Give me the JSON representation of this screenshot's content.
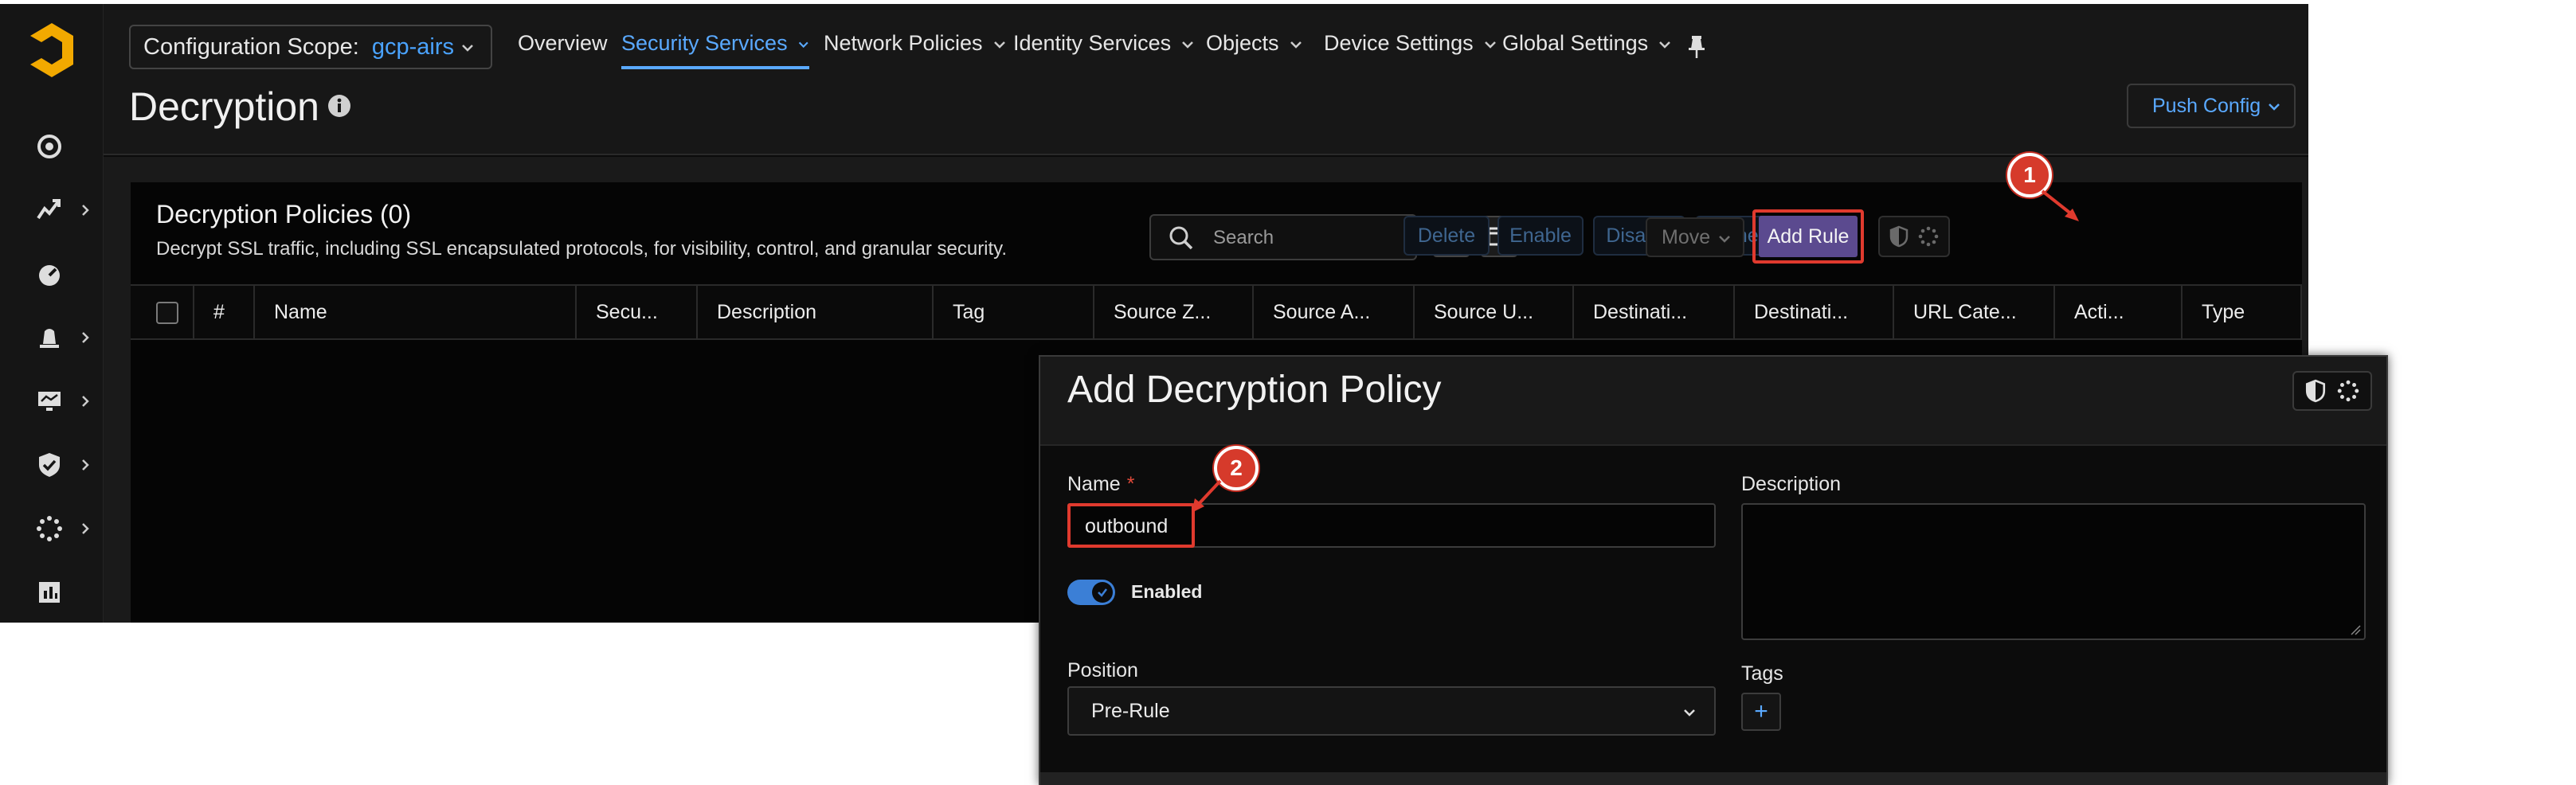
{
  "app": {
    "scope_label": "Configuration Scope:",
    "scope_value": "gcp-airs",
    "nav": [
      {
        "label": "Overview",
        "has_menu": false
      },
      {
        "label": "Security Services",
        "has_menu": true,
        "active": true
      },
      {
        "label": "Network Policies",
        "has_menu": true
      },
      {
        "label": "Identity Services",
        "has_menu": true
      },
      {
        "label": "Objects",
        "has_menu": true
      },
      {
        "label": "Device Settings",
        "has_menu": true
      },
      {
        "label": "Global Settings",
        "has_menu": true
      }
    ],
    "page_title": "Decryption",
    "push_config": "Push Config",
    "accent_color": "#5aa9ff",
    "brand_color": "#f2a900"
  },
  "sidebar": {
    "items": [
      {
        "icon": "target-icon",
        "has_chevron": false
      },
      {
        "icon": "activity-icon",
        "has_chevron": true
      },
      {
        "icon": "gauge-icon",
        "has_chevron": false
      },
      {
        "icon": "alert-icon",
        "has_chevron": true
      },
      {
        "icon": "monitor-icon",
        "has_chevron": true
      },
      {
        "icon": "shield-check-icon",
        "has_chevron": true
      },
      {
        "icon": "settings-dots-icon",
        "has_chevron": true
      },
      {
        "icon": "report-icon",
        "has_chevron": false
      }
    ]
  },
  "panel": {
    "title": "Decryption Policies (0)",
    "subtitle": "Decrypt SSL traffic, including SSL encapsulated protocols, for visibility, control, and granular security.",
    "search_placeholder": "Search",
    "actions": {
      "delete": "Delete",
      "enable": "Enable",
      "disable": "Disable",
      "clone": "Clone",
      "move": "Move",
      "add_rule": "Add Rule"
    },
    "columns": [
      "#",
      "Name",
      "Secu...",
      "Description",
      "Tag",
      "Source Z...",
      "Source A...",
      "Source U...",
      "Destinati...",
      "Destinati...",
      "URL Cate...",
      "Acti...",
      "Type"
    ]
  },
  "badges": [
    "1",
    "2"
  ],
  "annotation_color": "#e03a2e",
  "modal": {
    "title": "Add Decryption Policy",
    "name_label": "Name",
    "required_mark": "*",
    "name_value": "outbound",
    "enabled_label": "Enabled",
    "enabled": true,
    "position_label": "Position",
    "position_value": "Pre-Rule",
    "description_label": "Description",
    "tags_label": "Tags",
    "tags_add": "+"
  }
}
